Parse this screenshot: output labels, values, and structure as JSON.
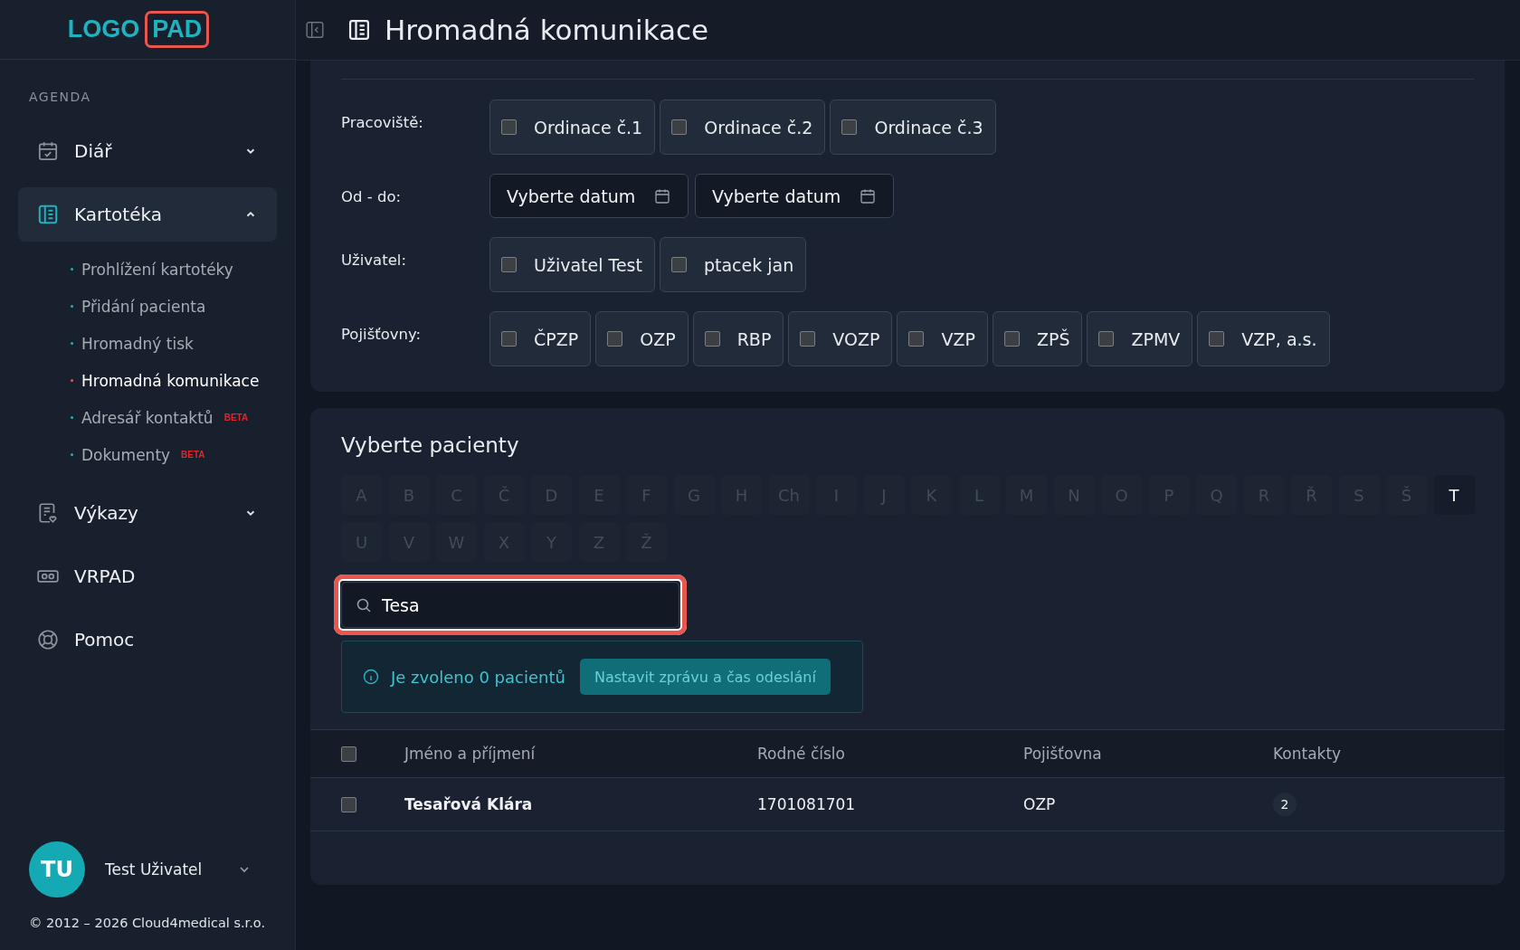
{
  "logo": {
    "text": "LOGO",
    "badge": "PAD",
    "badge_highlighted": true
  },
  "header": {
    "title": "Hromadná komunikace"
  },
  "sidebar": {
    "section": "AGENDA",
    "items": [
      {
        "label": "Diář",
        "expanded": false,
        "selected": false
      },
      {
        "label": "Kartotéka",
        "expanded": true,
        "selected": true,
        "children": [
          {
            "label": "Prohlížení kartotéky",
            "selected": false
          },
          {
            "label": "Přidání pacienta",
            "selected": false
          },
          {
            "label": "Hromadný tisk",
            "selected": false
          },
          {
            "label": "Hromadná komunikace",
            "selected": true
          },
          {
            "label": "Adresář kontaktů",
            "selected": false,
            "badge": "BETA"
          },
          {
            "label": "Dokumenty",
            "selected": false,
            "badge": "BETA"
          }
        ]
      },
      {
        "label": "Výkazy",
        "expanded": false,
        "selected": false
      },
      {
        "label": "VRPAD",
        "selected": false
      },
      {
        "label": "Pomoc",
        "selected": false
      }
    ],
    "user": {
      "initials": "TU",
      "name": "Test Uživatel"
    },
    "copyright": "© 2012 – 2026 Cloud4medical s.r.o."
  },
  "filters": [
    {
      "label": "Pracoviště:",
      "kind": "checks",
      "options": [
        {
          "label": "Ordinace č.1",
          "checked": false
        },
        {
          "label": "Ordinace č.2",
          "checked": false
        },
        {
          "label": "Ordinace č.3",
          "checked": false
        }
      ]
    },
    {
      "label": "Od - do:",
      "kind": "dates",
      "fields": [
        {
          "placeholder": "Vyberte datum"
        },
        {
          "placeholder": "Vyberte datum"
        }
      ]
    },
    {
      "label": "Uživatel:",
      "kind": "checks",
      "options": [
        {
          "label": "Uživatel Test",
          "checked": false
        },
        {
          "label": "ptacek jan",
          "checked": false
        }
      ]
    },
    {
      "label": "Pojišťovny:",
      "kind": "checks",
      "options": [
        {
          "label": "ČPZP",
          "checked": false
        },
        {
          "label": "OZP",
          "checked": false
        },
        {
          "label": "RBP",
          "checked": false
        },
        {
          "label": "VOZP",
          "checked": false
        },
        {
          "label": "VZP",
          "checked": false
        },
        {
          "label": "ZPŠ",
          "checked": false
        },
        {
          "label": "ZPMV",
          "checked": false
        },
        {
          "label": "VZP, a.s.",
          "checked": false
        }
      ]
    }
  ],
  "patients": {
    "title": "Vyberte pacienty",
    "letters": [
      {
        "label": "A",
        "disabled": true
      },
      {
        "label": "B",
        "disabled": true
      },
      {
        "label": "C",
        "disabled": true
      },
      {
        "label": "Č",
        "disabled": true
      },
      {
        "label": "D",
        "disabled": true
      },
      {
        "label": "E",
        "disabled": true
      },
      {
        "label": "F",
        "disabled": true
      },
      {
        "label": "G",
        "disabled": true
      },
      {
        "label": "H",
        "disabled": true
      },
      {
        "label": "Ch",
        "disabled": true
      },
      {
        "label": "I",
        "disabled": true
      },
      {
        "label": "J",
        "disabled": true
      },
      {
        "label": "K",
        "disabled": true
      },
      {
        "label": "L",
        "disabled": true
      },
      {
        "label": "M",
        "disabled": true
      },
      {
        "label": "N",
        "disabled": true
      },
      {
        "label": "O",
        "disabled": true
      },
      {
        "label": "P",
        "disabled": true
      },
      {
        "label": "Q",
        "disabled": true
      },
      {
        "label": "R",
        "disabled": true
      },
      {
        "label": "Ř",
        "disabled": true
      },
      {
        "label": "S",
        "disabled": true
      },
      {
        "label": "Š",
        "disabled": true
      },
      {
        "label": "T",
        "disabled": false
      },
      {
        "label": "U",
        "disabled": true
      },
      {
        "label": "V",
        "disabled": true
      },
      {
        "label": "W",
        "disabled": true
      },
      {
        "label": "X",
        "disabled": true
      },
      {
        "label": "Y",
        "disabled": true
      },
      {
        "label": "Z",
        "disabled": true
      },
      {
        "label": "Ž",
        "disabled": true
      }
    ],
    "search": {
      "value": "Tesa",
      "highlighted": true
    },
    "info": {
      "text": "Je zvoleno 0 pacientů",
      "button": "Nastavit zprávu a čas odeslání",
      "button_disabled": true
    },
    "table": {
      "all_checked": false,
      "columns": [
        "Jméno a příjmení",
        "Rodné číslo",
        "Pojišťovna",
        "Kontakty"
      ],
      "rows": [
        {
          "checked": false,
          "cells": [
            "Tesařová Klára",
            "1701081701",
            "OZP",
            "2"
          ]
        }
      ]
    }
  }
}
